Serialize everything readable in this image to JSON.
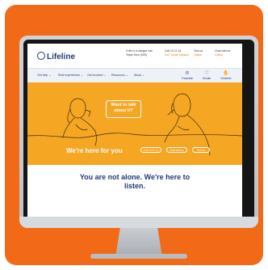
{
  "header": {
    "logo": "Lifeline",
    "crisis_line1": "If life is in danger call",
    "crisis_line2": "Triple Zero (000)",
    "call": {
      "line1": "Call 13 11 14",
      "line2": "24/7 Crisis Support"
    },
    "text": {
      "line1": "Text us",
      "line2": "Online"
    },
    "chat": {
      "line1": "Chat with us",
      "line2": "Online"
    }
  },
  "nav": {
    "items": [
      "Get help",
      "Real experiences",
      "Get involved",
      "Resources",
      "About"
    ],
    "actions": [
      {
        "label": "Fundraise",
        "icon": "crown-icon"
      },
      {
        "label": "Donate",
        "icon": "donate-icon"
      },
      {
        "label": "Volunteer",
        "icon": "volunteer-icon"
      }
    ]
  },
  "hero": {
    "bubble_line1": "Want to talk",
    "bubble_line2": "about it?",
    "title": "We're here for you",
    "buttons": [
      "Call 13 11 14",
      "Chat with us",
      "Text us"
    ]
  },
  "tagline": {
    "line1": "You are not alone. We're here to",
    "line2": "listen."
  },
  "colors": {
    "accent": "#f26a17",
    "hero": "#f5a623",
    "navy": "#213a7a"
  }
}
